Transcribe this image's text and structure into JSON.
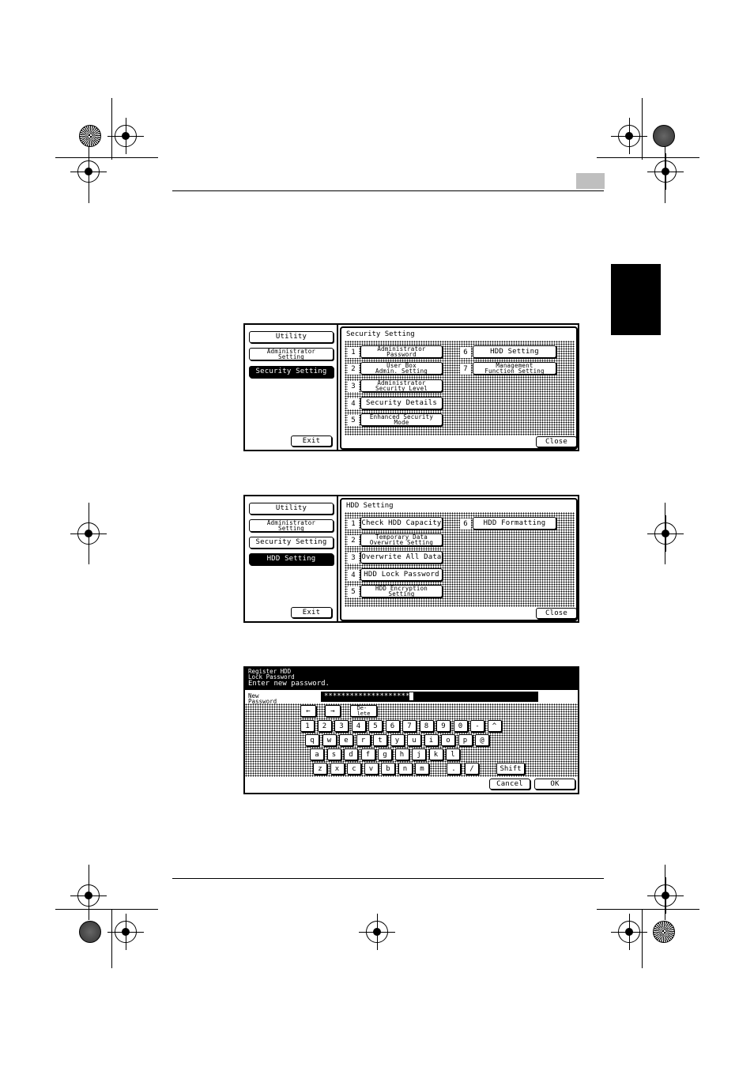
{
  "screen1": {
    "nav": {
      "utility": "Utility",
      "admin": "Administrator\nSetting",
      "current": "Security Setting",
      "exit": "Exit"
    },
    "title": "Security Setting",
    "items": [
      {
        "num": "1",
        "label": "Administrator\nPassword"
      },
      {
        "num": "2",
        "label": "User Box\nAdmin. Setting"
      },
      {
        "num": "3",
        "label": "Administrator\nSecurity Level"
      },
      {
        "num": "4",
        "label": "Security Details"
      },
      {
        "num": "5",
        "label": "Enhanced Security\nMode"
      },
      {
        "num": "6",
        "label": "HDD Setting"
      },
      {
        "num": "7",
        "label": "Management\nFunction Setting"
      }
    ],
    "close": "Close"
  },
  "screen2": {
    "nav": {
      "utility": "Utility",
      "admin": "Administrator\nSetting",
      "security": "Security Setting",
      "current": "HDD Setting",
      "exit": "Exit"
    },
    "title": "HDD Setting",
    "items": [
      {
        "num": "1",
        "label": "Check HDD Capacity"
      },
      {
        "num": "2",
        "label": "Temporary Data\nOverwrite Setting"
      },
      {
        "num": "3",
        "label": "Overwrite All Data"
      },
      {
        "num": "4",
        "label": "HDD Lock Password"
      },
      {
        "num": "5",
        "label": "HDD Encryption\nSetting"
      },
      {
        "num": "6",
        "label": "HDD Formatting"
      }
    ],
    "close": "Close"
  },
  "screen3": {
    "header_title": "Register HDD\nLock Password",
    "instruction": "Enter new password.",
    "field_label": "New\nPassword",
    "password_value": "********************",
    "left_arrow": "←",
    "right_arrow": "→",
    "delete": "De-\nlete",
    "row1": [
      "1",
      "2",
      "3",
      "4",
      "5",
      "6",
      "7",
      "8",
      "9",
      "0",
      "-",
      "^"
    ],
    "row2": [
      "q",
      "w",
      "e",
      "r",
      "t",
      "y",
      "u",
      "i",
      "o",
      "p",
      "@"
    ],
    "row3": [
      "a",
      "s",
      "d",
      "f",
      "g",
      "h",
      "j",
      "k",
      "l"
    ],
    "row4": [
      "z",
      "x",
      "c",
      "v",
      "b",
      "n",
      "m"
    ],
    "row4_extra": [
      ".",
      "/"
    ],
    "shift": "Shift",
    "cancel": "Cancel",
    "ok": "OK"
  }
}
